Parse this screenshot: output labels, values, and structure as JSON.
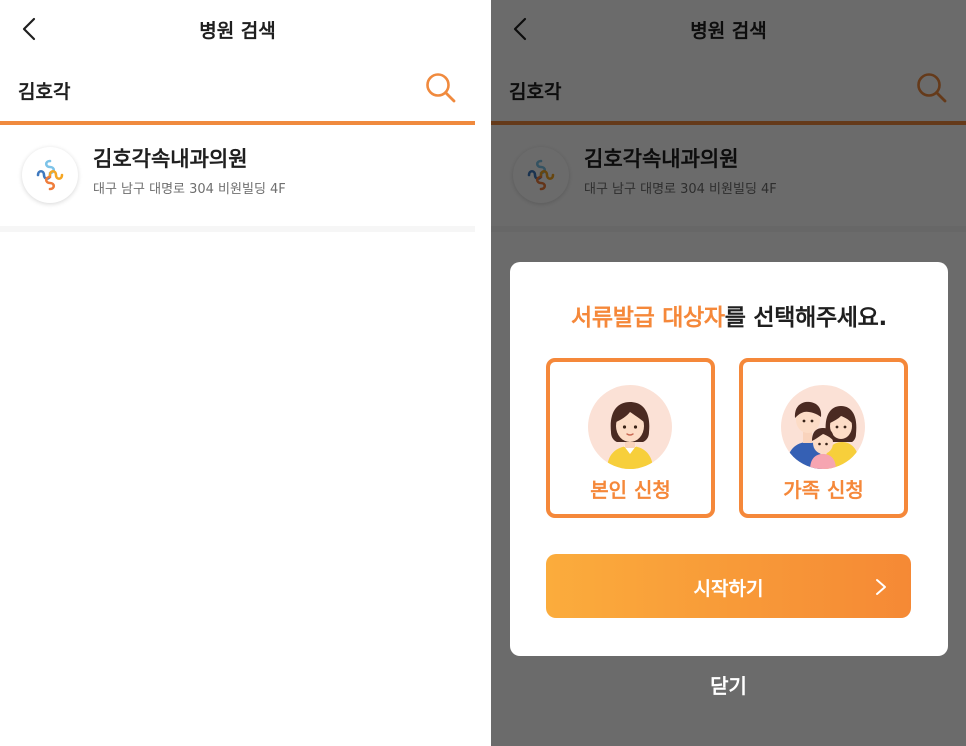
{
  "header": {
    "title": "병원 검색",
    "back_icon": "chevron-left-icon"
  },
  "search": {
    "value": "김호각",
    "icon": "search-icon",
    "accent_color": "#f08a3e"
  },
  "results": [
    {
      "name": "김호각속내과의원",
      "address": "대구 남구 대명로 304 비원빌딩 4F",
      "logo_icon": "hospital-cross-logo"
    }
  ],
  "modal": {
    "title_highlight_1": "서류발급",
    "title_highlight_2": "대상자",
    "title_rest": "를 선택해주세요.",
    "options": [
      {
        "label": "본인 신청",
        "icon": "woman-avatar-icon"
      },
      {
        "label": "가족 신청",
        "icon": "family-avatar-icon"
      }
    ],
    "start_label": "시작하기",
    "start_icon": "chevron-right-icon",
    "close_label": "닫기",
    "accent_color": "#f5883a"
  }
}
